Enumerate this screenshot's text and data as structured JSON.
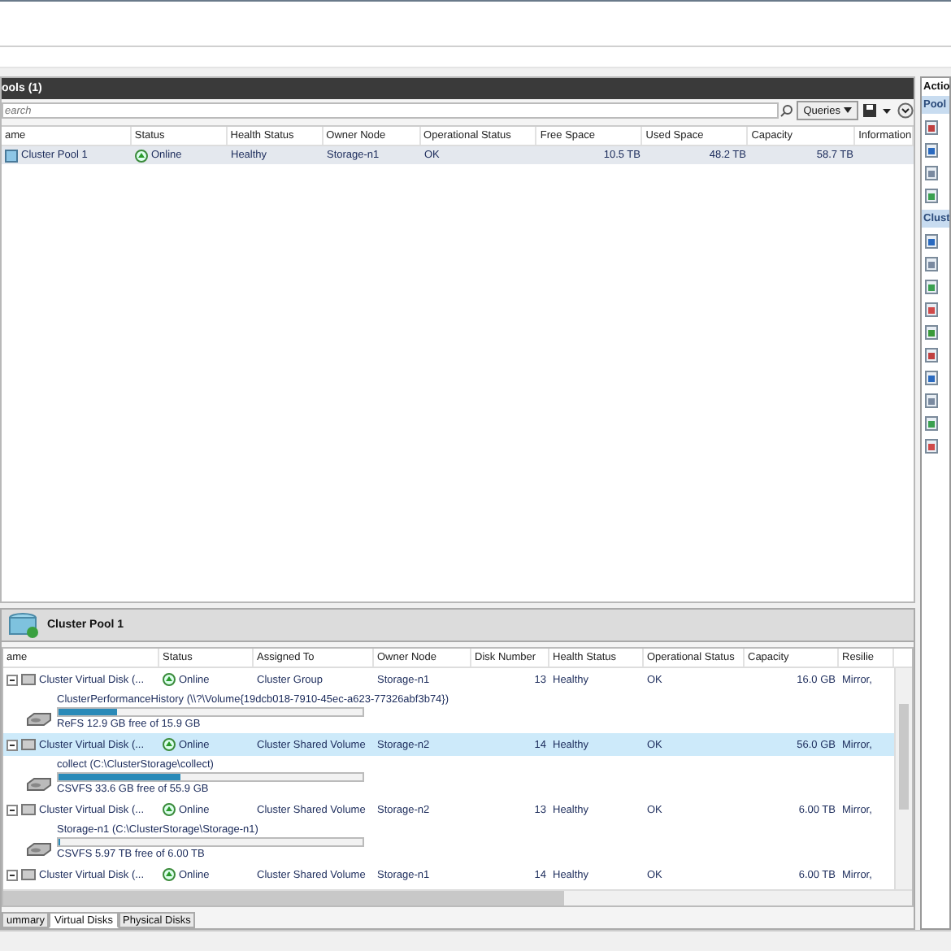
{
  "pools": {
    "title": "ools (1)",
    "search": {
      "placeholder": "earch"
    },
    "queries_button": "Queries",
    "columns": [
      "ame",
      "Status",
      "Health Status",
      "Owner Node",
      "Operational Status",
      "Free Space",
      "Used Space",
      "Capacity",
      "Information"
    ],
    "rows": [
      {
        "name": "Cluster Pool 1",
        "status": "Online",
        "health": "Healthy",
        "owner": "Storage-n1",
        "operational": "OK",
        "free": "10.5 TB",
        "used": "48.2 TB",
        "capacity": "58.7 TB",
        "selected": true
      }
    ]
  },
  "actions": {
    "title": "Actio",
    "sections": [
      {
        "title": "Pool"
      },
      {
        "title": "Clust"
      }
    ]
  },
  "detail": {
    "title": "Cluster Pool 1",
    "columns": [
      "ame",
      "Status",
      "Assigned To",
      "Owner Node",
      "Disk Number",
      "Health Status",
      "Operational Status",
      "Capacity",
      "Resilie"
    ],
    "disks": [
      {
        "name": "Cluster Virtual Disk (...",
        "status": "Online",
        "assigned": "Cluster Group",
        "owner": "Storage-n1",
        "number": "13",
        "health": "Healthy",
        "operational": "OK",
        "capacity": "16.0 GB",
        "resiliency": "Mirror,",
        "selected": false,
        "expanded": true,
        "volume": {
          "name": "ClusterPerformanceHistory (\\\\?\\Volume{19dcb018-7910-45ec-a623-77326abf3b74})",
          "level": 0.19,
          "free": "ReFS 12.9 GB free of 15.9 GB"
        }
      },
      {
        "name": "Cluster Virtual Disk (...",
        "status": "Online",
        "assigned": "Cluster Shared Volume",
        "owner": "Storage-n2",
        "number": "14",
        "health": "Healthy",
        "operational": "OK",
        "capacity": "56.0 GB",
        "resiliency": "Mirror,",
        "selected": true,
        "expanded": true,
        "volume": {
          "name": "collect (C:\\ClusterStorage\\collect)",
          "level": 0.4,
          "free": "CSVFS 33.6 GB free of 55.9 GB"
        }
      },
      {
        "name": "Cluster Virtual Disk (...",
        "status": "Online",
        "assigned": "Cluster Shared Volume",
        "owner": "Storage-n2",
        "number": "13",
        "health": "Healthy",
        "operational": "OK",
        "capacity": "6.00 TB",
        "resiliency": "Mirror,",
        "selected": false,
        "expanded": true,
        "volume": {
          "name": "Storage-n1 (C:\\ClusterStorage\\Storage-n1)",
          "level": 0.005,
          "free": "CSVFS 5.97 TB free of 6.00 TB"
        }
      },
      {
        "name": "Cluster Virtual Disk (...",
        "status": "Online",
        "assigned": "Cluster Shared Volume",
        "owner": "Storage-n1",
        "number": "14",
        "health": "Healthy",
        "operational": "OK",
        "capacity": "6.00 TB",
        "resiliency": "Mirror,",
        "selected": false,
        "expanded": true
      }
    ],
    "tabs": [
      {
        "label": "ummary",
        "selected": false
      },
      {
        "label": "Virtual Disks",
        "selected": true
      },
      {
        "label": "Physical Disks",
        "selected": false
      }
    ]
  }
}
